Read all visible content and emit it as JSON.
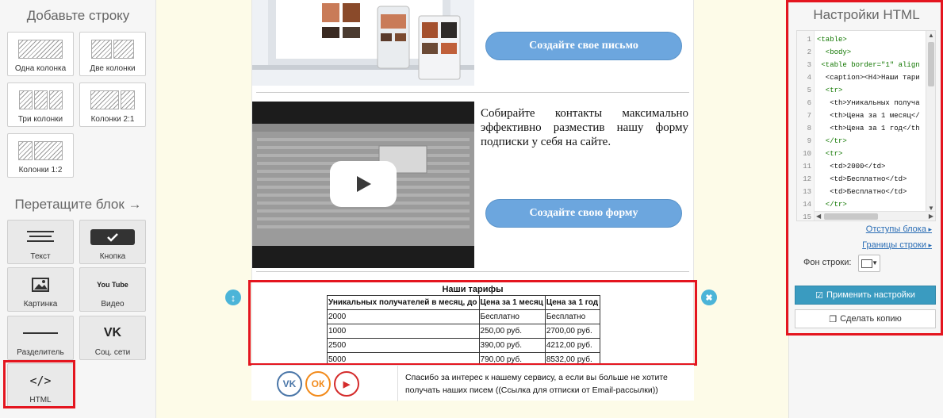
{
  "left_panel": {
    "add_row_title": "Добавьте строку",
    "rows": [
      {
        "label": "Одна колонка"
      },
      {
        "label": "Две колонки"
      },
      {
        "label": "Три колонки"
      },
      {
        "label": "Колонки 2:1"
      },
      {
        "label": "Колонки 1:2"
      }
    ],
    "drag_block_title": "Перетащите блок →",
    "blocks": [
      {
        "label": "Текст",
        "icon": "text-lines-icon"
      },
      {
        "label": "Кнопка",
        "icon": "button-check-icon"
      },
      {
        "label": "Картинка",
        "icon": "image-icon"
      },
      {
        "label": "Видео",
        "icon": "youtube-icon",
        "icon_text": "You Tube"
      },
      {
        "label": "Разделитель",
        "icon": "divider-line-icon"
      },
      {
        "label": "Соц. сети",
        "icon": "vk-icon",
        "icon_text": "VK"
      },
      {
        "label": "HTML",
        "icon": "code-brackets-icon",
        "icon_text": "</>"
      }
    ]
  },
  "canvas": {
    "cta_letter": "Создайте свое письмо",
    "description": "Собирайте контакты максимально эффективно разместив нашу форму подписки у себя на сайте.",
    "cta_form": "Создайте свою форму",
    "html_block": {
      "caption": "Наши тарифы",
      "headers": [
        "Уникальных получателей в месяц, до",
        "Цена за 1 месяц",
        "Цена за 1 год"
      ],
      "rows": [
        [
          "2000",
          "Бесплатно",
          "Бесплатно"
        ],
        [
          "1000",
          "250,00 руб.",
          "2700,00 руб."
        ],
        [
          "2500",
          "390,00 руб.",
          "4212,00 руб."
        ],
        [
          "5000",
          "790,00 руб.",
          "8532,00 руб."
        ]
      ],
      "move_icon": "↕",
      "close_icon": "✖"
    },
    "footer": {
      "social": [
        {
          "name": "vk",
          "label": "VK",
          "color": "#4a76a8"
        },
        {
          "name": "odnoklassniki",
          "label": "ОК",
          "color": "#f28a1a"
        },
        {
          "name": "youtube",
          "label": "▶",
          "color": "#d42b2b"
        }
      ],
      "text": "Спасибо за интерес к нашему сервису, а если вы больше не хотите получать наших писем ((Ссылка для отписки от Email-рассылки))"
    }
  },
  "right_panel": {
    "title": "Настройки HTML",
    "code_lines": [
      {
        "n": "1",
        "text": "<table>"
      },
      {
        "n": "2",
        "text": "  <body>"
      },
      {
        "n": "3",
        "text": " <table border=\"1\" align"
      },
      {
        "n": "4",
        "text": "  <caption><H4>Наши тари"
      },
      {
        "n": "5",
        "text": "  <tr>"
      },
      {
        "n": "6",
        "text": "   <th>Уникальных получа"
      },
      {
        "n": "7",
        "text": "   <th>Цена за 1 месяц</"
      },
      {
        "n": "8",
        "text": "   <th>Цена за 1 год</th"
      },
      {
        "n": "9",
        "text": "  </tr>"
      },
      {
        "n": "10",
        "text": "  <tr>"
      },
      {
        "n": "11",
        "text": "   <td>2000</td>"
      },
      {
        "n": "12",
        "text": "   <td>Бесплатно</td>"
      },
      {
        "n": "13",
        "text": "   <td>Бесплатно</td>"
      },
      {
        "n": "14",
        "text": "  </tr>"
      },
      {
        "n": "15",
        "text": ""
      }
    ],
    "link_padding": "Отступы блока",
    "link_borders": "Границы строки",
    "row_bg_label": "Фон строки:",
    "row_bg_color": "#ffffff",
    "apply_button": "Применить настройки",
    "copy_button": "Сделать копию"
  },
  "colors": {
    "accent_blue": "#6ca6de",
    "apply_blue": "#3a9bc0",
    "highlight_red": "#e4151f",
    "canvas_bg": "#fdfbe8"
  }
}
